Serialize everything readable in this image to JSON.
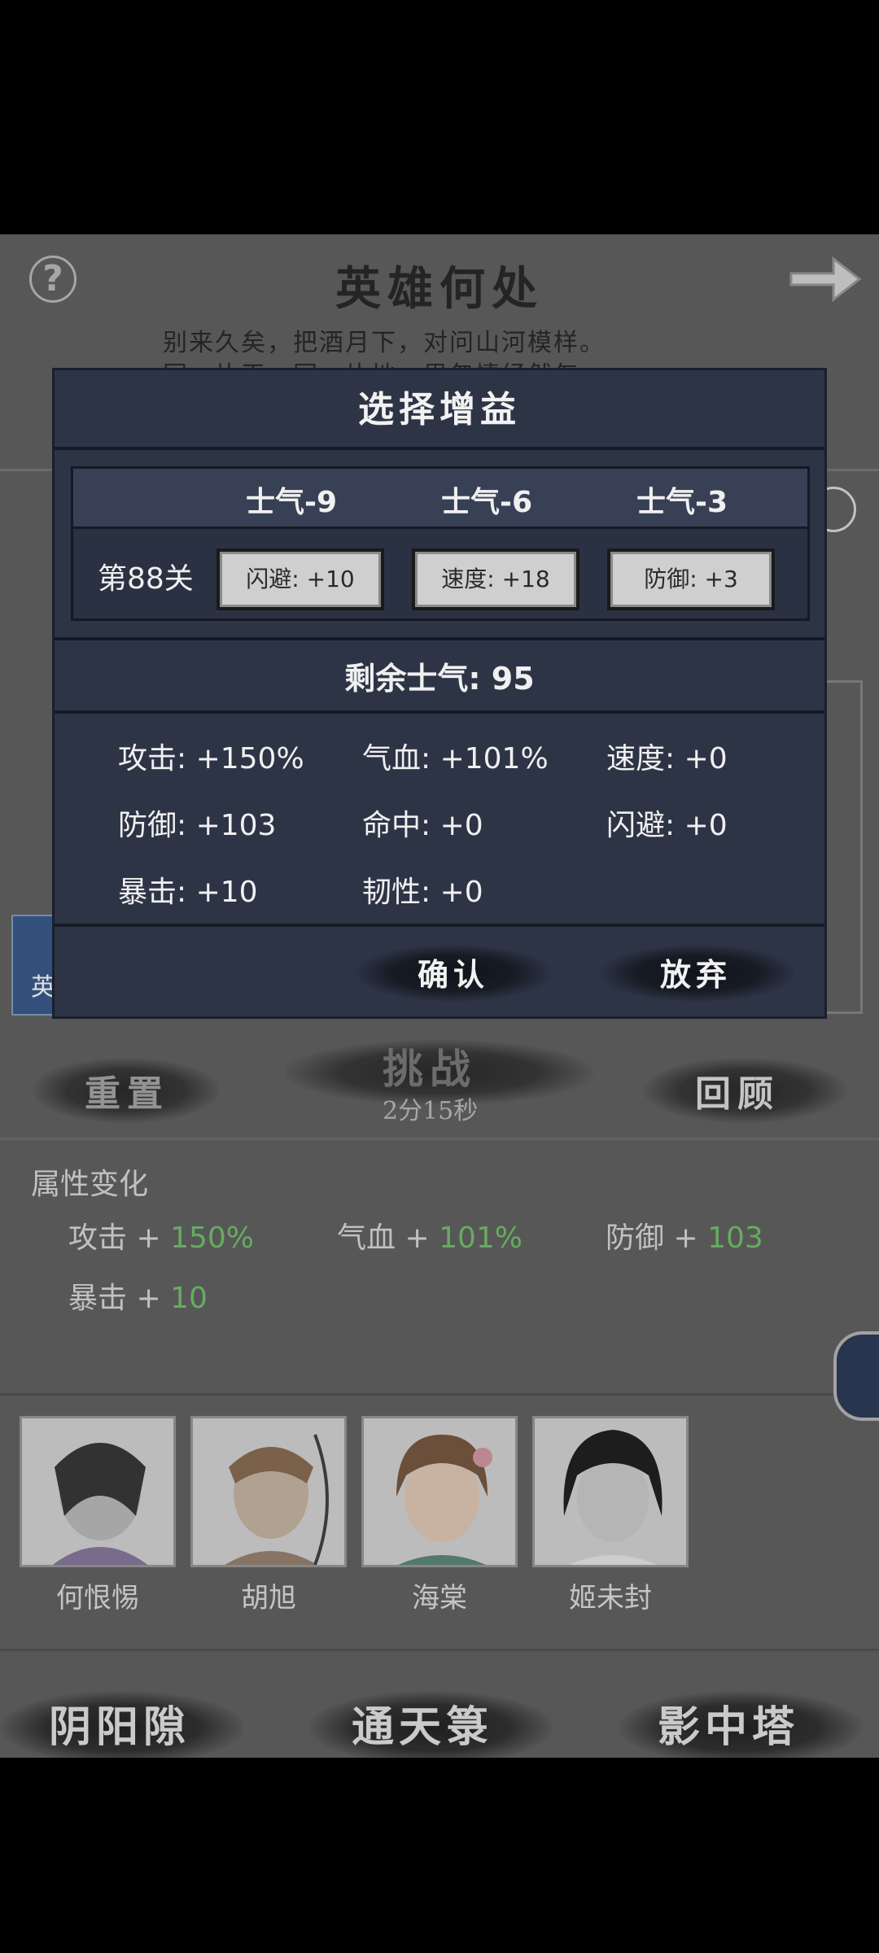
{
  "header": {
    "title": "英雄何处",
    "subtitle_line1": "别来久矣，把酒月下，对问山河模样。",
    "subtitle_line2": "同一片天，同一片地，思忽情经然怎"
  },
  "side_tile": {
    "label": "英"
  },
  "actions": {
    "reset": "重置",
    "challenge": "挑战",
    "timer": "2分15秒",
    "review": "回顾"
  },
  "attribute_changes": {
    "title": "属性变化",
    "items": [
      {
        "name": "攻击",
        "plus": "+",
        "value": "150%"
      },
      {
        "name": "气血",
        "plus": "+",
        "value": "101%"
      },
      {
        "name": "防御",
        "plus": "+",
        "value": "103"
      },
      {
        "name": "暴击",
        "plus": "+",
        "value": "10"
      }
    ]
  },
  "heroes": [
    {
      "name": "何恨惕"
    },
    {
      "name": "胡旭"
    },
    {
      "name": "海棠"
    },
    {
      "name": "姬未封"
    }
  ],
  "bottom_nav": [
    "阴阳隙",
    "通天箓",
    "影中塔"
  ],
  "modal": {
    "title": "选择增益",
    "morale_costs": [
      "士气-9",
      "士气-6",
      "士气-3"
    ],
    "level": "第88关",
    "buffs": [
      "闪避: +10",
      "速度: +18",
      "防御: +3"
    ],
    "remaining_morale": "剩余士气: 95",
    "stats": [
      "攻击: +150%",
      "气血: +101%",
      "速度: +0",
      "防御: +103",
      "命中: +0",
      "闪避: +0",
      "暴击: +10",
      "韧性: +0"
    ],
    "confirm": "确认",
    "abandon": "放弃"
  },
  "colors": {
    "background": "#636363",
    "modal_bg": "#2d3446",
    "positive_value": "#76c36e"
  }
}
